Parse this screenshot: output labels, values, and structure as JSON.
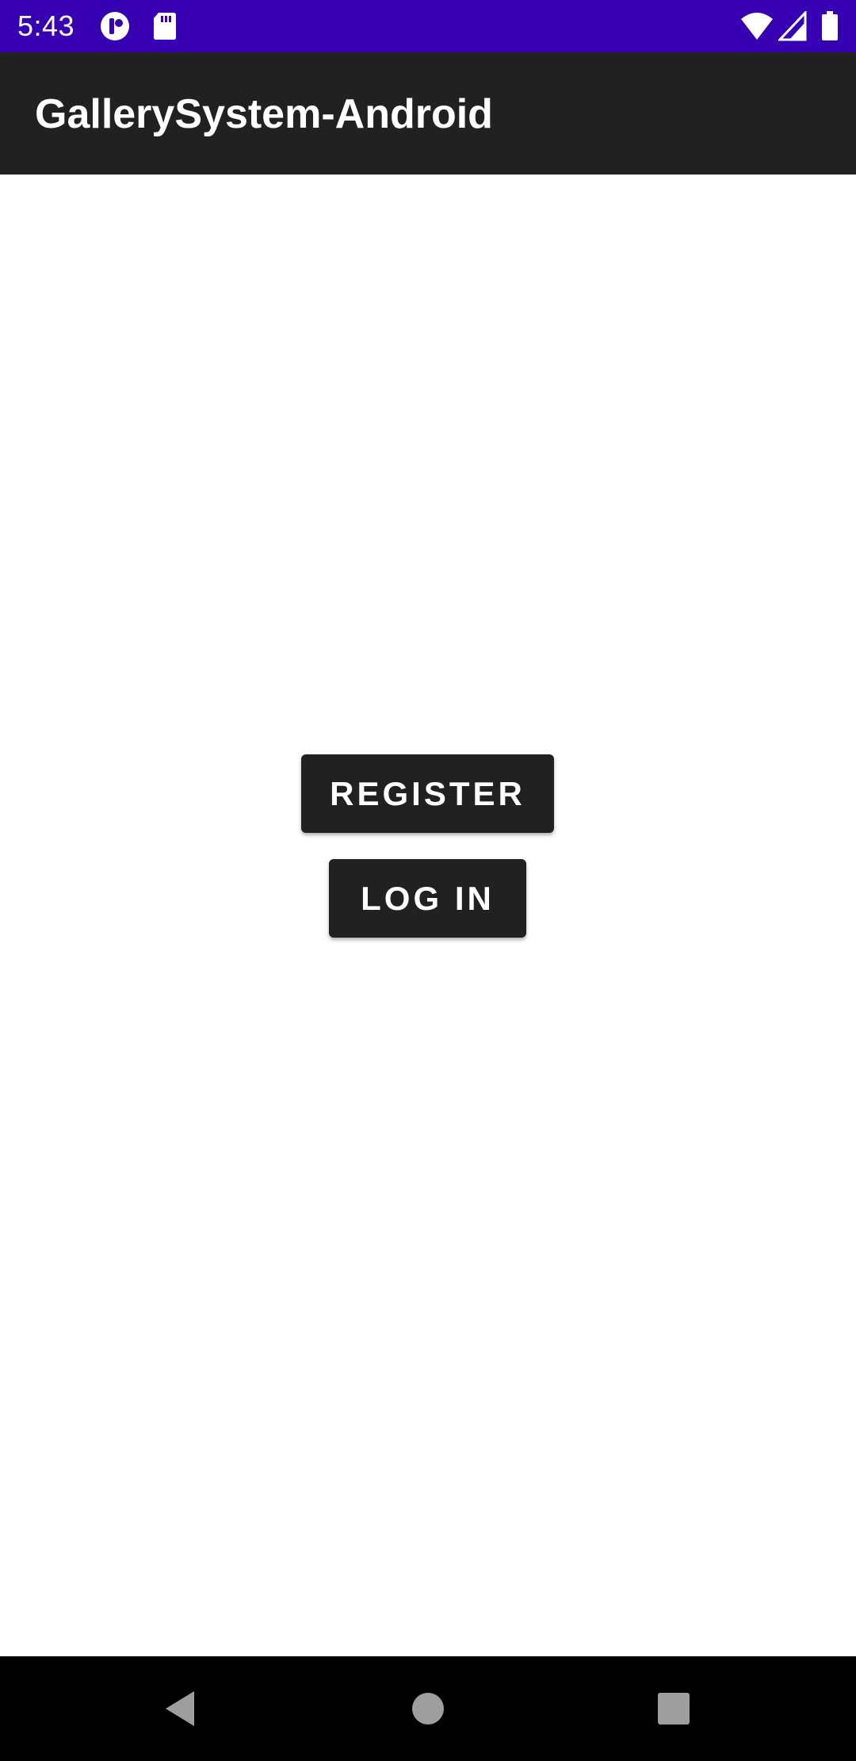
{
  "status_bar": {
    "time": "5:43",
    "color": "#3700b3",
    "icons_left": [
      "notification-p-icon",
      "sd-card-icon"
    ],
    "icons_right": [
      "wifi-icon",
      "cell-signal-icon",
      "battery-icon"
    ]
  },
  "app_bar": {
    "title": "GallerySystem-Android",
    "color": "#212121"
  },
  "main": {
    "register_label": "REGISTER",
    "login_label": "LOG IN",
    "button_color": "#212121"
  },
  "nav_bar": {
    "items": [
      "back-icon",
      "home-icon",
      "recents-icon"
    ]
  }
}
